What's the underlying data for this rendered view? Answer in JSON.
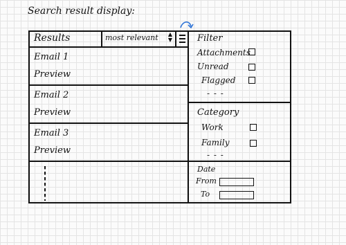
{
  "page": {
    "title": "Search result display:"
  },
  "results": {
    "header": "Results",
    "sort": {
      "selected": "most relevant",
      "arrows_icon": "sort-arrows-icon"
    },
    "filter_toggle_icon": "hamburger-icon",
    "emails": [
      {
        "subject": "Email 1",
        "preview": "Preview"
      },
      {
        "subject": "Email 2",
        "preview": "Preview"
      },
      {
        "subject": "Email 3",
        "preview": "Preview"
      }
    ]
  },
  "filter": {
    "heading": "Filter",
    "options": [
      {
        "label": "Attachments",
        "checked": false
      },
      {
        "label": "Unread",
        "checked": false
      },
      {
        "label": "Flagged",
        "checked": false
      }
    ],
    "more": "- - -"
  },
  "category": {
    "heading": "Category",
    "options": [
      {
        "label": "Work",
        "checked": false
      },
      {
        "label": "Family",
        "checked": false
      }
    ],
    "more": "- - -"
  },
  "date": {
    "heading": "Date",
    "from_label": "From",
    "to_label": "To",
    "from_value": "",
    "to_value": ""
  }
}
